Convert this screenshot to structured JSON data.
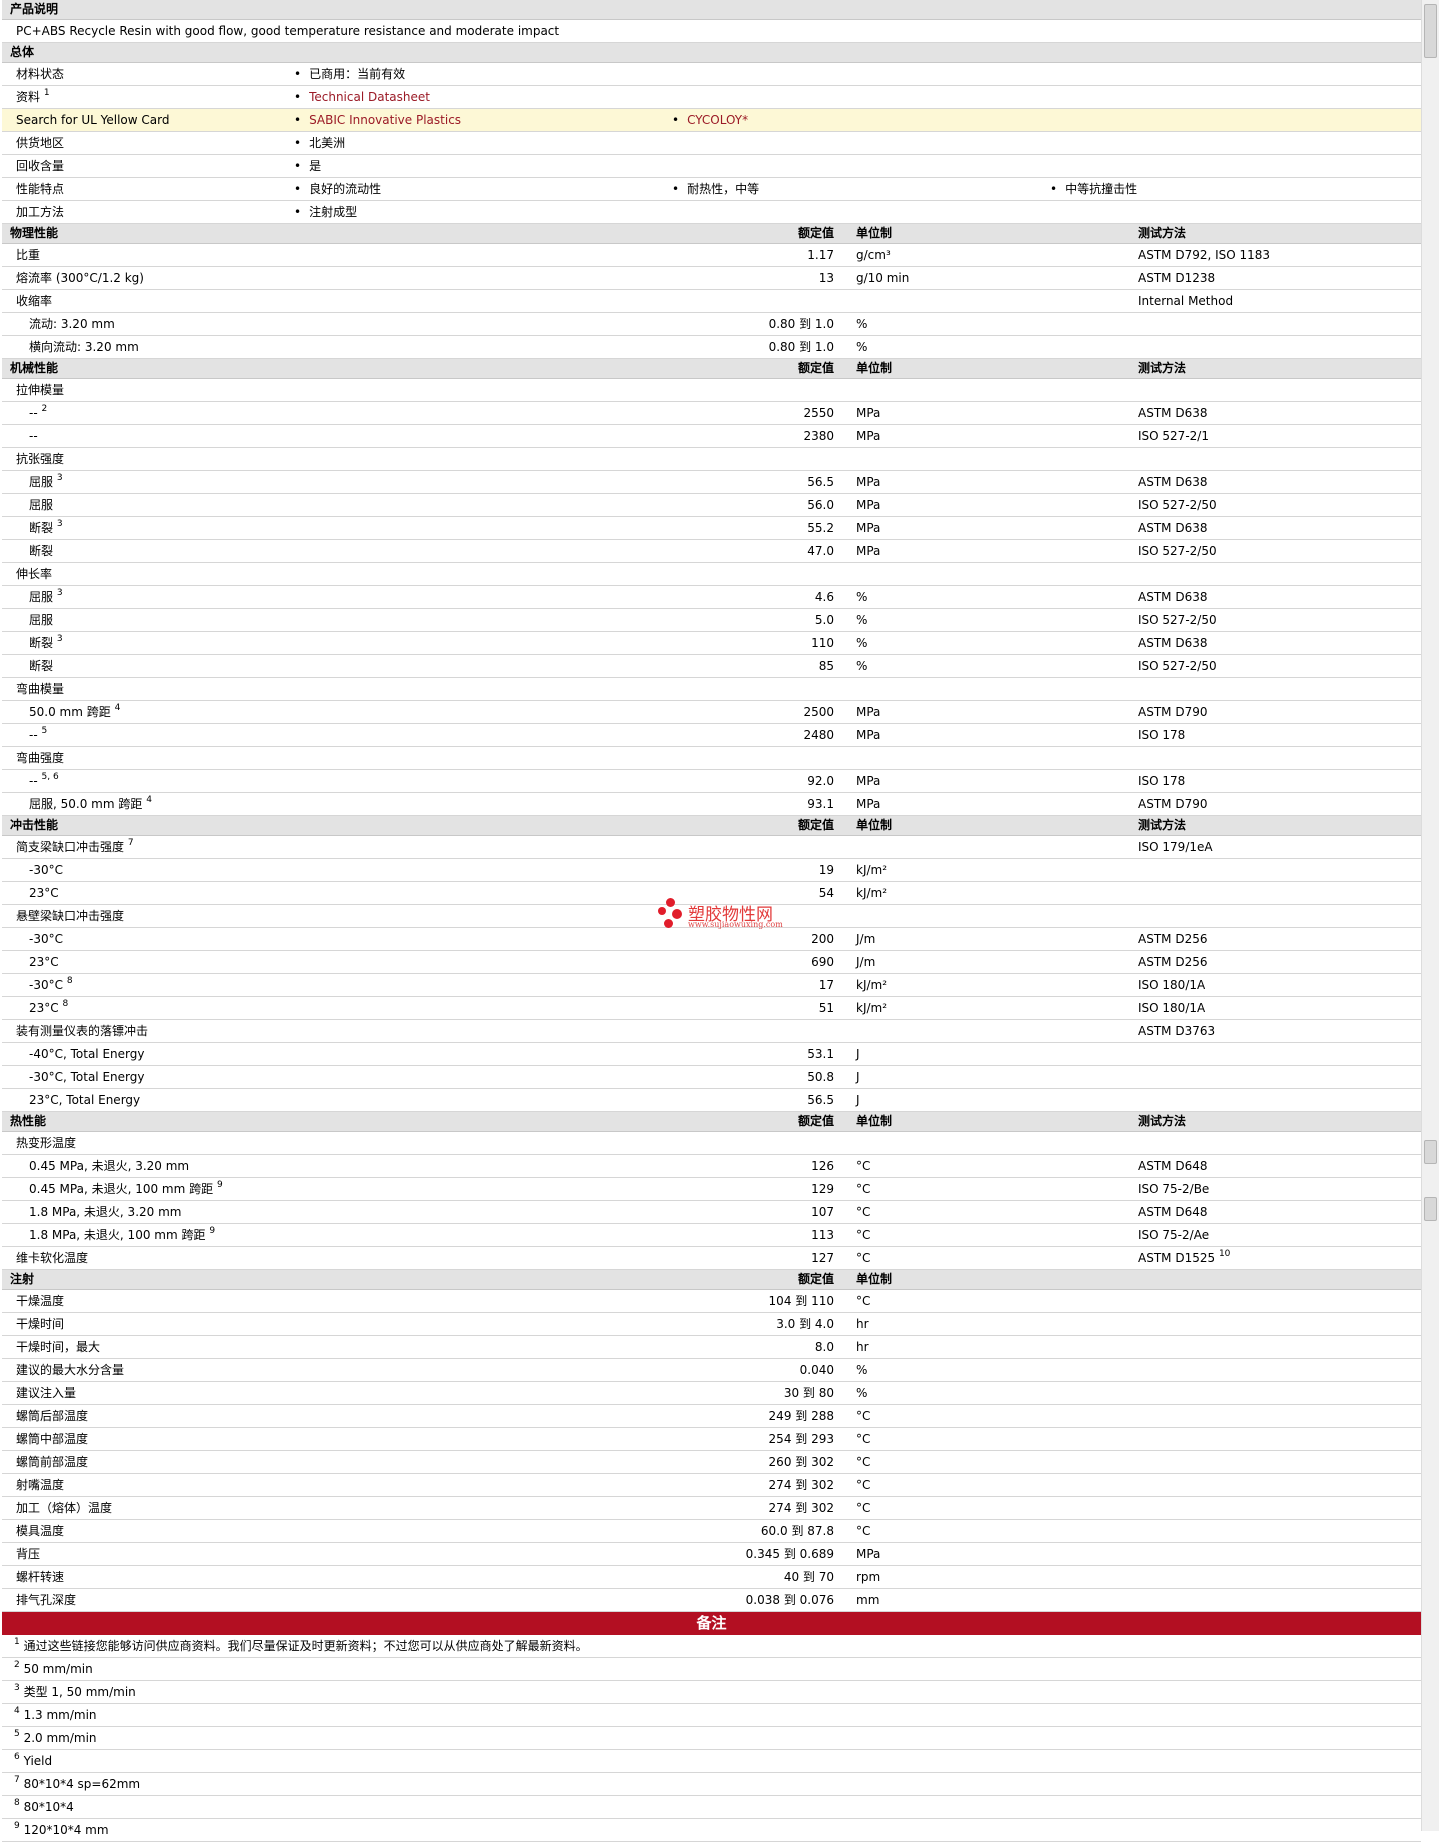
{
  "product_desc": {
    "title": "产品说明",
    "text": "PC+ABS Recycle Resin with good flow, good temperature resistance and moderate impact"
  },
  "general": {
    "title": "总体",
    "status_label": "材料状态",
    "status_value": "已商用：当前有效",
    "docs_label": "资料",
    "docs_sup": "1",
    "docs_link": "Technical Datasheet",
    "ul_label": "Search for UL Yellow Card",
    "ul_link1": "SABIC Innovative Plastics",
    "ul_link2": "CYCOLOY*",
    "region_label": "供货地区",
    "region_value": "北美洲",
    "recycle_label": "回收含量",
    "recycle_value": "是",
    "features_label": "性能特点",
    "feature1": "良好的流动性",
    "feature2": "耐热性，中等",
    "feature3": "中等抗撞击性",
    "process_label": "加工方法",
    "process_value": "注射成型"
  },
  "headers": {
    "nominal": "额定值",
    "unit": "单位制",
    "method": "测试方法"
  },
  "physical": {
    "title": "物理性能",
    "rows": [
      {
        "label": "比重",
        "sup": "",
        "indent": false,
        "value": "1.17",
        "unit": "g/cm³",
        "method": "ASTM D792, ISO 1183"
      },
      {
        "label": "熔流率 (300°C/1.2 kg)",
        "sup": "",
        "indent": false,
        "value": "13",
        "unit": "g/10 min",
        "method": "ASTM D1238"
      },
      {
        "label": "收缩率",
        "sup": "",
        "indent": false,
        "value": "",
        "unit": "",
        "method": "Internal Method"
      },
      {
        "label": "流动: 3.20 mm",
        "sup": "",
        "indent": true,
        "value": "0.80 到  1.0",
        "unit": "%",
        "method": ""
      },
      {
        "label": "横向流动: 3.20 mm",
        "sup": "",
        "indent": true,
        "value": "0.80 到  1.0",
        "unit": "%",
        "method": ""
      }
    ]
  },
  "mechanical": {
    "title": "机械性能",
    "rows": [
      {
        "label": "拉伸模量",
        "sup": "",
        "indent": false,
        "value": "",
        "unit": "",
        "method": ""
      },
      {
        "label": "--",
        "sup": "2",
        "indent": true,
        "value": "2550",
        "unit": "MPa",
        "method": "ASTM D638"
      },
      {
        "label": "--",
        "sup": "",
        "indent": true,
        "value": "2380",
        "unit": "MPa",
        "method": "ISO 527-2/1"
      },
      {
        "label": "抗张强度",
        "sup": "",
        "indent": false,
        "value": "",
        "unit": "",
        "method": ""
      },
      {
        "label": "屈服",
        "sup": "3",
        "indent": true,
        "value": "56.5",
        "unit": "MPa",
        "method": "ASTM D638"
      },
      {
        "label": "屈服",
        "sup": "",
        "indent": true,
        "value": "56.0",
        "unit": "MPa",
        "method": "ISO 527-2/50"
      },
      {
        "label": "断裂",
        "sup": "3",
        "indent": true,
        "value": "55.2",
        "unit": "MPa",
        "method": "ASTM D638"
      },
      {
        "label": "断裂",
        "sup": "",
        "indent": true,
        "value": "47.0",
        "unit": "MPa",
        "method": "ISO 527-2/50"
      },
      {
        "label": "伸长率",
        "sup": "",
        "indent": false,
        "value": "",
        "unit": "",
        "method": ""
      },
      {
        "label": "屈服",
        "sup": "3",
        "indent": true,
        "value": "4.6",
        "unit": "%",
        "method": "ASTM D638"
      },
      {
        "label": "屈服",
        "sup": "",
        "indent": true,
        "value": "5.0",
        "unit": "%",
        "method": "ISO 527-2/50"
      },
      {
        "label": "断裂",
        "sup": "3",
        "indent": true,
        "value": "110",
        "unit": "%",
        "method": "ASTM D638"
      },
      {
        "label": "断裂",
        "sup": "",
        "indent": true,
        "value": "85",
        "unit": "%",
        "method": "ISO 527-2/50"
      },
      {
        "label": "弯曲模量",
        "sup": "",
        "indent": false,
        "value": "",
        "unit": "",
        "method": ""
      },
      {
        "label": "50.0 mm 跨距",
        "sup": "4",
        "indent": true,
        "value": "2500",
        "unit": "MPa",
        "method": "ASTM D790"
      },
      {
        "label": "--",
        "sup": "5",
        "indent": true,
        "value": "2480",
        "unit": "MPa",
        "method": "ISO 178"
      },
      {
        "label": "弯曲强度",
        "sup": "",
        "indent": false,
        "value": "",
        "unit": "",
        "method": ""
      },
      {
        "label": "--",
        "sup": "5, 6",
        "indent": true,
        "value": "92.0",
        "unit": "MPa",
        "method": "ISO 178"
      },
      {
        "label": "屈服, 50.0 mm 跨距",
        "sup": "4",
        "indent": true,
        "value": "93.1",
        "unit": "MPa",
        "method": "ASTM D790"
      }
    ]
  },
  "impact": {
    "title": "冲击性能",
    "rows": [
      {
        "label": "简支梁缺口冲击强度",
        "sup": "7",
        "indent": false,
        "value": "",
        "unit": "",
        "method": "ISO 179/1eA"
      },
      {
        "label": "-30°C",
        "sup": "",
        "indent": true,
        "value": "19",
        "unit": "kJ/m²",
        "method": ""
      },
      {
        "label": "23°C",
        "sup": "",
        "indent": true,
        "value": "54",
        "unit": "kJ/m²",
        "method": ""
      },
      {
        "label": "悬壁梁缺口冲击强度",
        "sup": "",
        "indent": false,
        "value": "",
        "unit": "",
        "method": ""
      },
      {
        "label": "-30°C",
        "sup": "",
        "indent": true,
        "value": "200",
        "unit": "J/m",
        "method": "ASTM D256"
      },
      {
        "label": "23°C",
        "sup": "",
        "indent": true,
        "value": "690",
        "unit": "J/m",
        "method": "ASTM D256"
      },
      {
        "label": "-30°C",
        "sup": "8",
        "indent": true,
        "value": "17",
        "unit": "kJ/m²",
        "method": "ISO 180/1A"
      },
      {
        "label": "23°C",
        "sup": "8",
        "indent": true,
        "value": "51",
        "unit": "kJ/m²",
        "method": "ISO 180/1A"
      },
      {
        "label": "装有测量仪表的落镖冲击",
        "sup": "",
        "indent": false,
        "value": "",
        "unit": "",
        "method": "ASTM D3763"
      },
      {
        "label": "-40°C, Total Energy",
        "sup": "",
        "indent": true,
        "value": "53.1",
        "unit": "J",
        "method": ""
      },
      {
        "label": "-30°C, Total Energy",
        "sup": "",
        "indent": true,
        "value": "50.8",
        "unit": "J",
        "method": ""
      },
      {
        "label": "23°C, Total Energy",
        "sup": "",
        "indent": true,
        "value": "56.5",
        "unit": "J",
        "method": ""
      }
    ]
  },
  "thermal": {
    "title": "热性能",
    "rows": [
      {
        "label": "热变形温度",
        "sup": "",
        "indent": false,
        "value": "",
        "unit": "",
        "method": ""
      },
      {
        "label": "0.45 MPa, 未退火, 3.20 mm",
        "sup": "",
        "indent": true,
        "value": "126",
        "unit": "°C",
        "method": "ASTM D648"
      },
      {
        "label": "0.45 MPa, 未退火, 100 mm 跨距",
        "sup": "9",
        "indent": true,
        "value": "129",
        "unit": "°C",
        "method": "ISO 75-2/Be"
      },
      {
        "label": "1.8 MPa, 未退火, 3.20 mm",
        "sup": "",
        "indent": true,
        "value": "107",
        "unit": "°C",
        "method": "ASTM D648"
      },
      {
        "label": "1.8 MPa, 未退火, 100 mm 跨距",
        "sup": "9",
        "indent": true,
        "value": "113",
        "unit": "°C",
        "method": "ISO 75-2/Ae"
      },
      {
        "label": "维卡软化温度",
        "sup": "",
        "indent": false,
        "value": "127",
        "unit": "°C",
        "method": "ASTM D1525",
        "method_sup": "10"
      }
    ]
  },
  "injection": {
    "title": "注射",
    "rows": [
      {
        "label": "干燥温度",
        "sup": "",
        "indent": false,
        "value": "104 到  110",
        "unit": "°C",
        "method": ""
      },
      {
        "label": "干燥时间",
        "sup": "",
        "indent": false,
        "value": "3.0 到  4.0",
        "unit": "hr",
        "method": ""
      },
      {
        "label": "干燥时间，最大",
        "sup": "",
        "indent": false,
        "value": "8.0",
        "unit": "hr",
        "method": ""
      },
      {
        "label": "建议的最大水分含量",
        "sup": "",
        "indent": false,
        "value": "0.040",
        "unit": "%",
        "method": ""
      },
      {
        "label": "建议注入量",
        "sup": "",
        "indent": false,
        "value": "30 到  80",
        "unit": "%",
        "method": ""
      },
      {
        "label": "螺筒后部温度",
        "sup": "",
        "indent": false,
        "value": "249 到  288",
        "unit": "°C",
        "method": ""
      },
      {
        "label": "螺筒中部温度",
        "sup": "",
        "indent": false,
        "value": "254 到  293",
        "unit": "°C",
        "method": ""
      },
      {
        "label": "螺筒前部温度",
        "sup": "",
        "indent": false,
        "value": "260 到  302",
        "unit": "°C",
        "method": ""
      },
      {
        "label": "射嘴温度",
        "sup": "",
        "indent": false,
        "value": "274 到  302",
        "unit": "°C",
        "method": ""
      },
      {
        "label": "加工（熔体）温度",
        "sup": "",
        "indent": false,
        "value": "274 到  302",
        "unit": "°C",
        "method": ""
      },
      {
        "label": "模具温度",
        "sup": "",
        "indent": false,
        "value": "60.0 到  87.8",
        "unit": "°C",
        "method": ""
      },
      {
        "label": "背压",
        "sup": "",
        "indent": false,
        "value": "0.345 到  0.689",
        "unit": "MPa",
        "method": ""
      },
      {
        "label": "螺杆转速",
        "sup": "",
        "indent": false,
        "value": "40 到  70",
        "unit": "rpm",
        "method": ""
      },
      {
        "label": "排气孔深度",
        "sup": "",
        "indent": false,
        "value": "0.038 到  0.076",
        "unit": "mm",
        "method": ""
      }
    ]
  },
  "notes": {
    "title": "备注",
    "items": [
      {
        "n": "1",
        "text": "通过这些链接您能够访问供应商资料。我们尽量保证及时更新资料；不过您可以从供应商处了解最新资料。"
      },
      {
        "n": "2",
        "text": "50 mm/min"
      },
      {
        "n": "3",
        "text": "类型  1, 50 mm/min"
      },
      {
        "n": "4",
        "text": "1.3 mm/min"
      },
      {
        "n": "5",
        "text": "2.0 mm/min"
      },
      {
        "n": "6",
        "text": "Yield"
      },
      {
        "n": "7",
        "text": "80*10*4 sp=62mm"
      },
      {
        "n": "8",
        "text": "80*10*4"
      },
      {
        "n": "9",
        "text": "120*10*4 mm"
      }
    ]
  },
  "watermark": {
    "title": "塑胶物性网",
    "url": "www.sujiaowuxing.com"
  }
}
